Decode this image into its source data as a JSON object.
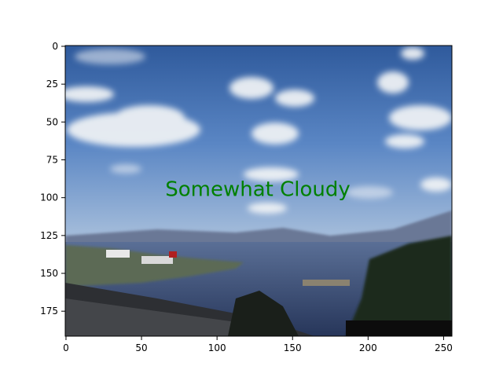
{
  "figure": {
    "overlay_text": "Somewhat Cloudy",
    "overlay_color": "#008000",
    "overlay_position_data": [
      127,
      95
    ],
    "image_size": [
      256,
      192
    ],
    "x_ticks": [
      "0",
      "50",
      "100",
      "150",
      "200",
      "250"
    ],
    "y_ticks": [
      "0",
      "25",
      "50",
      "75",
      "100",
      "125",
      "150",
      "175"
    ]
  }
}
